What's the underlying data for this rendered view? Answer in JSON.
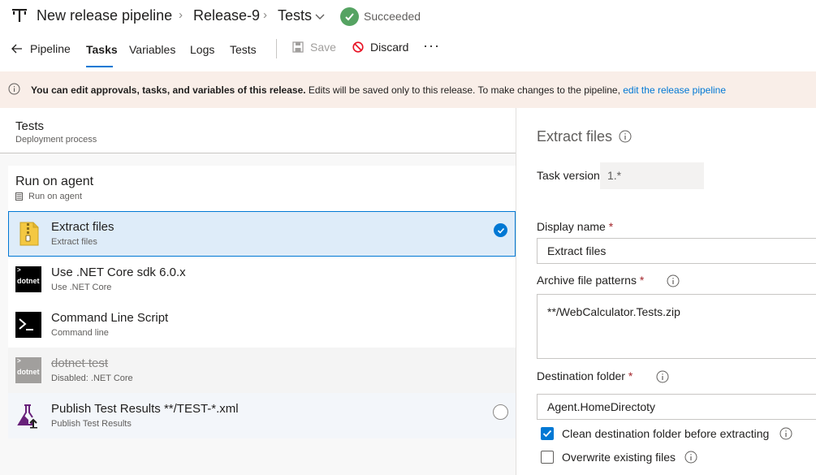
{
  "header": {
    "breadcrumb": [
      "New release pipeline",
      "Release-9",
      "Tests"
    ],
    "status": "Succeeded",
    "colors": {
      "success": "#55a362",
      "accent": "#0078d4",
      "discard": "#e81123"
    }
  },
  "toolbar": {
    "back_label": "Pipeline",
    "tabs": [
      "Tasks",
      "Variables",
      "Logs",
      "Tests"
    ],
    "active_tab": "Tasks",
    "save_label": "Save",
    "discard_label": "Discard",
    "more_label": "···"
  },
  "banner": {
    "bold": "You can edit approvals, tasks, and variables of this release.",
    "text": " Edits will be saved only to this release. To make changes to the pipeline, ",
    "link": "edit the release pipeline"
  },
  "stage": {
    "title": "Tests",
    "subtitle": "Deployment process"
  },
  "agent_job": {
    "title": "Run on agent",
    "subtitle": "Run on agent"
  },
  "tasks": [
    {
      "title": "Extract files",
      "subtitle": "Extract files",
      "icon": "zip-archive-icon",
      "state": "selected"
    },
    {
      "title": "Use .NET Core sdk 6.0.x",
      "subtitle": "Use .NET Core",
      "icon": "dotnet-icon",
      "icon_text": "dotnet",
      "state": "normal"
    },
    {
      "title": "Command Line Script",
      "subtitle": "Command line",
      "icon": "terminal-icon",
      "state": "normal"
    },
    {
      "title": "dotnet test",
      "subtitle": "Disabled: .NET Core",
      "icon": "dotnet-icon",
      "icon_text": "dotnet",
      "state": "disabled"
    },
    {
      "title": "Publish Test Results **/TEST-*.xml",
      "subtitle": "Publish Test Results",
      "icon": "flask-upload-icon",
      "state": "hover"
    }
  ],
  "details": {
    "title": "Extract files",
    "task_version_label": "Task version",
    "task_version_value": "1.*",
    "display_name_label": "Display name",
    "display_name_value": "Extract files",
    "archive_patterns_label": "Archive file patterns",
    "archive_patterns_value": "**/WebCalculator.Tests.zip",
    "destination_label": "Destination folder",
    "destination_value": "Agent.HomeDirectoty",
    "required_mark": "*",
    "clean_label": "Clean destination folder before extracting",
    "clean_checked": true,
    "overwrite_label": "Overwrite existing files",
    "overwrite_checked": false
  }
}
